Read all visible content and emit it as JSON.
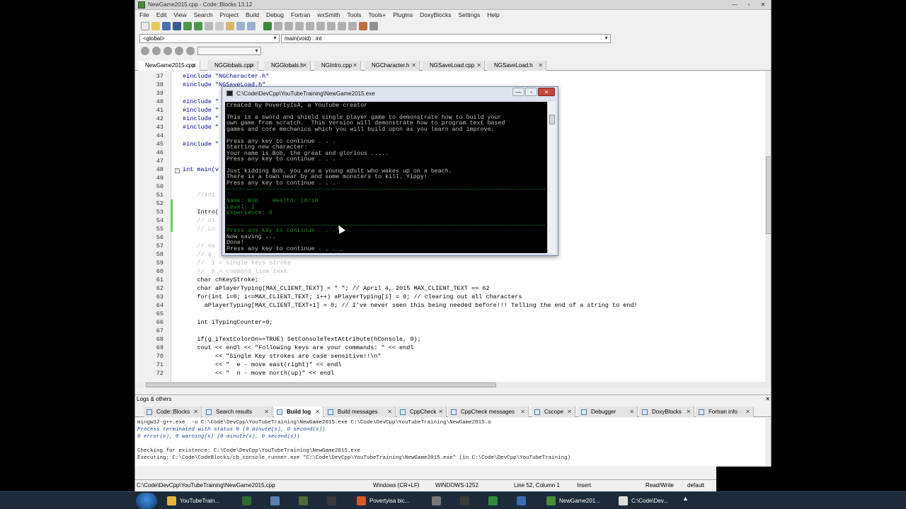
{
  "window": {
    "title": "NewGame2015.cpp - Code::Blocks 13.12",
    "buttons": [
      "—",
      "▫",
      "✕"
    ]
  },
  "menu": [
    "File",
    "Edit",
    "View",
    "Search",
    "Project",
    "Build",
    "Debug",
    "Fortran",
    "wxSmith",
    "Tools",
    "Tools+",
    "Plugins",
    "DoxyBlocks",
    "Settings",
    "Help"
  ],
  "scope": {
    "global": "<global>",
    "function": "main(void) : int"
  },
  "tabs": [
    {
      "label": "NewGame2015.cpp",
      "active": true
    },
    {
      "label": "NGGlobals.cpp"
    },
    {
      "label": "NGGlobals.h"
    },
    {
      "label": "NGIntro.cpp"
    },
    {
      "label": "NGCharacter.h"
    },
    {
      "label": "NGSaveLoad.cpp"
    },
    {
      "label": "NGSaveLoad.h"
    }
  ],
  "code": [
    {
      "n": "37",
      "t": "#include \"NGCharacter.h\"",
      "c": "str"
    },
    {
      "n": "38",
      "t": "#include \"NGSaveLoad.h\"",
      "c": "str"
    },
    {
      "n": "39",
      "t": ""
    },
    {
      "n": "40",
      "t": "#include \"",
      "c": "str"
    },
    {
      "n": "41",
      "t": "#include \"",
      "c": "str"
    },
    {
      "n": "42",
      "t": "#include \"",
      "c": "str"
    },
    {
      "n": "43",
      "t": "#include \"",
      "c": "str"
    },
    {
      "n": "44",
      "t": ""
    },
    {
      "n": "45",
      "t": "#include \"",
      "c": "str"
    },
    {
      "n": "46",
      "t": ""
    },
    {
      "n": "47",
      "t": ""
    },
    {
      "n": "48",
      "t": "int main(v",
      "c": "kw"
    },
    {
      "n": "49",
      "t": ""
    },
    {
      "n": "50",
      "t": ""
    },
    {
      "n": "51",
      "t": "    //Ini",
      "c": "cm"
    },
    {
      "n": "52",
      "t": ""
    },
    {
      "n": "53",
      "t": "    Intro("
    },
    {
      "n": "54",
      "t": "    // cl",
      "c": "cm"
    },
    {
      "n": "55",
      "t": "    // Lo",
      "c": "cm"
    },
    {
      "n": "56",
      "t": ""
    },
    {
      "n": "57",
      "t": "    // va",
      "c": "cm"
    },
    {
      "n": "58",
      "t": "    // g_",
      "c": "cm"
    },
    {
      "n": "59",
      "t": "    //  1 = single keys stroke",
      "c": "cm"
    },
    {
      "n": "60",
      "t": "    //  0 = command line text",
      "c": "cm"
    },
    {
      "n": "61",
      "t": "    char chKeyStroke;"
    },
    {
      "n": "62",
      "t": "    char aPlayerTyping[MAX_CLIENT_TEXT] = \" \"; // April 4, 2015 MAX_CLIENT_TEXT == 62"
    },
    {
      "n": "63",
      "t": "    for(int i=0; i<=MAX_CLIENT_TEXT; i++) aPlayerTyping[i] = 0; // clearing out all characters"
    },
    {
      "n": "64",
      "t": "      aPlayerTyping[MAX_CLIENT_TEXT+1] = 0; // I've never seen this being needed before!!! Telling the end of a string to end!"
    },
    {
      "n": "65",
      "t": ""
    },
    {
      "n": "66",
      "t": "    int iTypingCounter=0;"
    },
    {
      "n": "67",
      "t": ""
    },
    {
      "n": "68",
      "t": "    if(g_iTextColorOn==TRUE) SetConsoleTextAttribute(hConsole, 9);"
    },
    {
      "n": "69",
      "t": "    cout << endl << \"Following keys are your commands: \" << endl"
    },
    {
      "n": "70",
      "t": "         << \"Single Key strokes are case sensitive!!\\n\""
    },
    {
      "n": "71",
      "t": "         << \"  e - move east(right)\" << endl"
    },
    {
      "n": "72",
      "t": "         << \"  n - move north(up)\" << endl"
    }
  ],
  "logs": {
    "header": "Logs & others",
    "tabs": [
      "Code::Blocks",
      "Search results",
      "Build log",
      "Build messages",
      "CppCheck",
      "CppCheck messages",
      "Cscope",
      "Debugger",
      "DoxyBlocks",
      "Fortran info"
    ],
    "lines": [
      {
        "t": "mingw32-g++.exe  -o C:\\Code\\DevCpp\\YouTubeTraining\\NewGame2015.exe C:\\Code\\DevCpp\\YouTubeTraining\\NewGame2015.o"
      },
      {
        "t": "Process terminated with status 0 (0 minute(s), 0 second(s))",
        "c": "blue"
      },
      {
        "t": "0 error(s), 0 warning(s) (0 minute(s), 0 second(s))",
        "c": "blue"
      },
      {
        "t": ""
      },
      {
        "t": "Checking for existence: C:\\Code\\DevCpp\\YouTubeTraining\\NewGame2015.exe"
      },
      {
        "t": "Executing: C:\\Code\\CodeBlocks/cb_console_runner.exe \"C:\\Code\\DevCpp\\YouTubeTraining\\NewGame2015.exe\" (in C:\\Code\\DevCpp\\YouTubeTraining)"
      }
    ]
  },
  "status": {
    "path": "C:\\Code\\DevCpp\\YouTubeTraining\\NewGame2015.cpp",
    "eol": "Windows (CR+LF)",
    "encoding": "WINDOWS-1252",
    "position": "Line 52, Column 1",
    "mode": "Insert",
    "access": "Read/Write",
    "profile": "default"
  },
  "console": {
    "title": "C:\\Code\\DevCpp\\YouTubeTraining\\NewGame2015.exe",
    "lines": [
      {
        "t": "Created by PovertyIsA, a YouTube creator"
      },
      {
        "t": ""
      },
      {
        "t": "This is a sword and shield single player game to demonstrate how to build your"
      },
      {
        "t": "own game from scratch.  This version will demonstrate how to program text based"
      },
      {
        "t": "games and core mechanics which you will build upon as you learn and improve."
      },
      {
        "t": ""
      },
      {
        "t": "Press any key to continue . . ."
      },
      {
        "t": "Starting new character:"
      },
      {
        "t": "Your name is Bob, the great and glorious ....."
      },
      {
        "t": "Press any key to continue . . ."
      },
      {
        "t": ""
      },
      {
        "t": "Just kidding Bob, you are a young adult who wakes up on a beach."
      },
      {
        "t": "There is a town near by and some monsters to kill. Yippy!"
      },
      {
        "t": "Press any key to continue . . ."
      },
      {
        "t": "",
        "sep": true
      },
      {
        "t": ""
      },
      {
        "t": "Name: Bob    Health: 10/10",
        "c": "green"
      },
      {
        "t": "Level: 1",
        "c": "green"
      },
      {
        "t": "Experience: 0",
        "c": "green"
      },
      {
        "t": ""
      },
      {
        "t": "",
        "sep": true
      },
      {
        "t": "Press any key to continue . . .",
        "c": "green"
      },
      {
        "t": "Now saving ..."
      },
      {
        "t": "Done!"
      },
      {
        "t": "Press any key to continue . . . _"
      }
    ]
  },
  "taskbar": [
    {
      "label": "YouTubeTrain...",
      "color": "#e3b53a"
    },
    {
      "label": "",
      "color": "#2e6b2e"
    },
    {
      "label": "",
      "color": "#5a7fb0"
    },
    {
      "label": "",
      "color": "#4e6a3a"
    },
    {
      "label": "",
      "color": "#3a3a3a"
    },
    {
      "label": "Povertyisa bic...",
      "color": "#d4582a"
    },
    {
      "label": "",
      "color": "#777777"
    },
    {
      "label": "",
      "color": "#3a3a3a"
    },
    {
      "label": "",
      "color": "#2e8a3a"
    },
    {
      "label": "",
      "color": "#3a6ab0"
    },
    {
      "label": "NewGame201...",
      "color": "#4a8a3a"
    },
    {
      "label": "C:\\Code\\Dev...",
      "color": "#dddddd"
    }
  ]
}
